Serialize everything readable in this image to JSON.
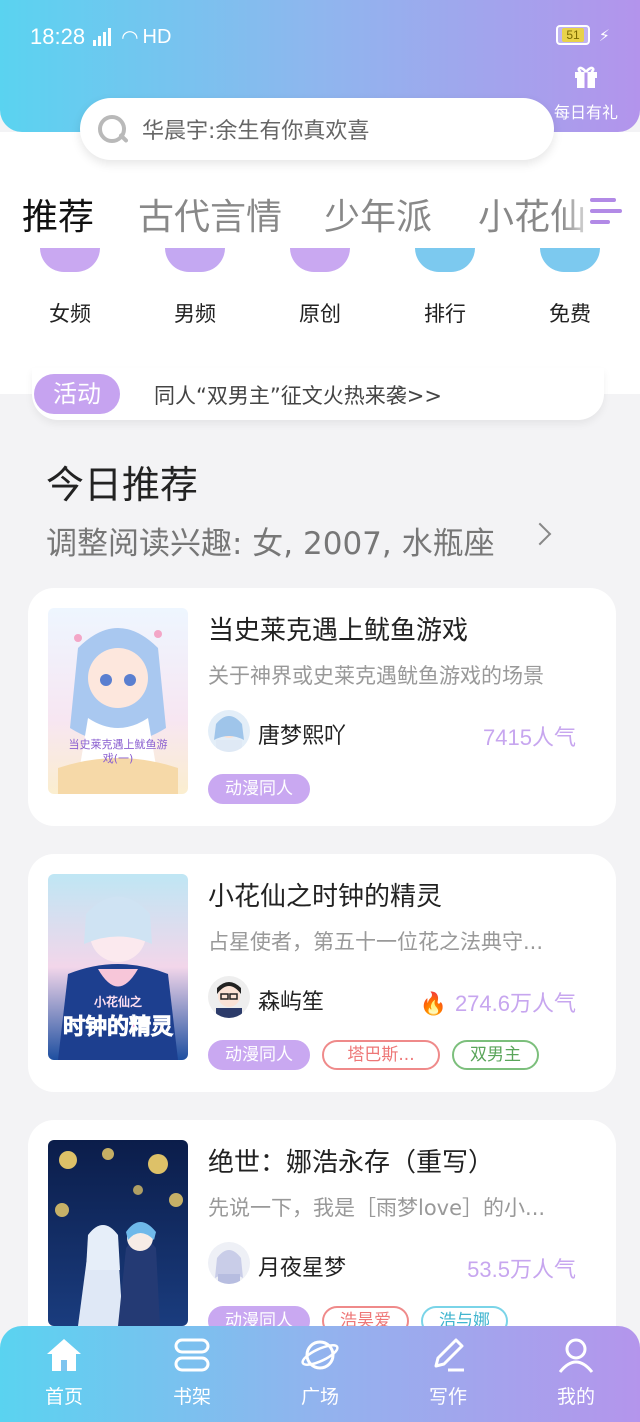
{
  "status_bar": {
    "time": "18:28",
    "signal_label": "4G",
    "network": "HD",
    "battery": "51"
  },
  "header": {
    "search_placeholder": "华晨宇:余生有你真欢喜",
    "gift_label": "每日有礼",
    "gift_icon": "gift-icon"
  },
  "tabs": [
    {
      "label": "推荐",
      "active": true
    },
    {
      "label": "古代言情",
      "active": false
    },
    {
      "label": "少年派",
      "active": false
    },
    {
      "label": "小花仙",
      "active": false
    }
  ],
  "categories": [
    {
      "label": "女频",
      "color": "#c9a8f1"
    },
    {
      "label": "男频",
      "color": "#c4a8f2"
    },
    {
      "label": "原创",
      "color": "#c9a8f1"
    },
    {
      "label": "排行",
      "color": "#7cc9ef"
    },
    {
      "label": "免费",
      "color": "#7cc9ef"
    }
  ],
  "activity": {
    "badge": "活动",
    "text": "同人“双男主”征文火热来袭>>"
  },
  "section": {
    "title": "今日推荐",
    "subtitle": "调整阅读兴趣: 女, 2007, 水瓶座"
  },
  "books": [
    {
      "title": "当史莱克遇上鱿鱼游戏",
      "desc": "关于神界或史莱克遇鱿鱼游戏的场景",
      "author": "唐梦熙吖",
      "popularity": "7415人气",
      "cover_text": "当史莱克遇上鱿鱼游戏(一)",
      "tags": [
        {
          "label": "动漫同人",
          "style": "fill"
        }
      ]
    },
    {
      "title": "小花仙之时钟的精灵",
      "desc": "占星使者，第五十一位花之法典守...",
      "author": "森屿笙",
      "popularity": "274.6万人气",
      "cover_text": "小花仙之 时钟的精灵",
      "tags": [
        {
          "label": "动漫同人",
          "style": "fill"
        },
        {
          "label": "塔巴斯...",
          "style": "red"
        },
        {
          "label": "双男主",
          "style": "green"
        }
      ]
    },
    {
      "title": "绝世：娜浩永存（重写）",
      "desc": "先说一下，我是［雨梦love］的小...",
      "author": "月夜星梦",
      "popularity": "53.5万人气",
      "tags": [
        {
          "label": "动漫同人",
          "style": "fill"
        },
        {
          "label": "浩昊爱",
          "style": "red"
        },
        {
          "label": "浩与娜",
          "style": "blue"
        }
      ]
    }
  ],
  "bottom_nav": [
    {
      "label": "首页",
      "icon": "home-icon"
    },
    {
      "label": "书架",
      "icon": "bookshelf-icon"
    },
    {
      "label": "广场",
      "icon": "planet-icon"
    },
    {
      "label": "写作",
      "icon": "pen-icon"
    },
    {
      "label": "我的",
      "icon": "user-icon"
    }
  ]
}
